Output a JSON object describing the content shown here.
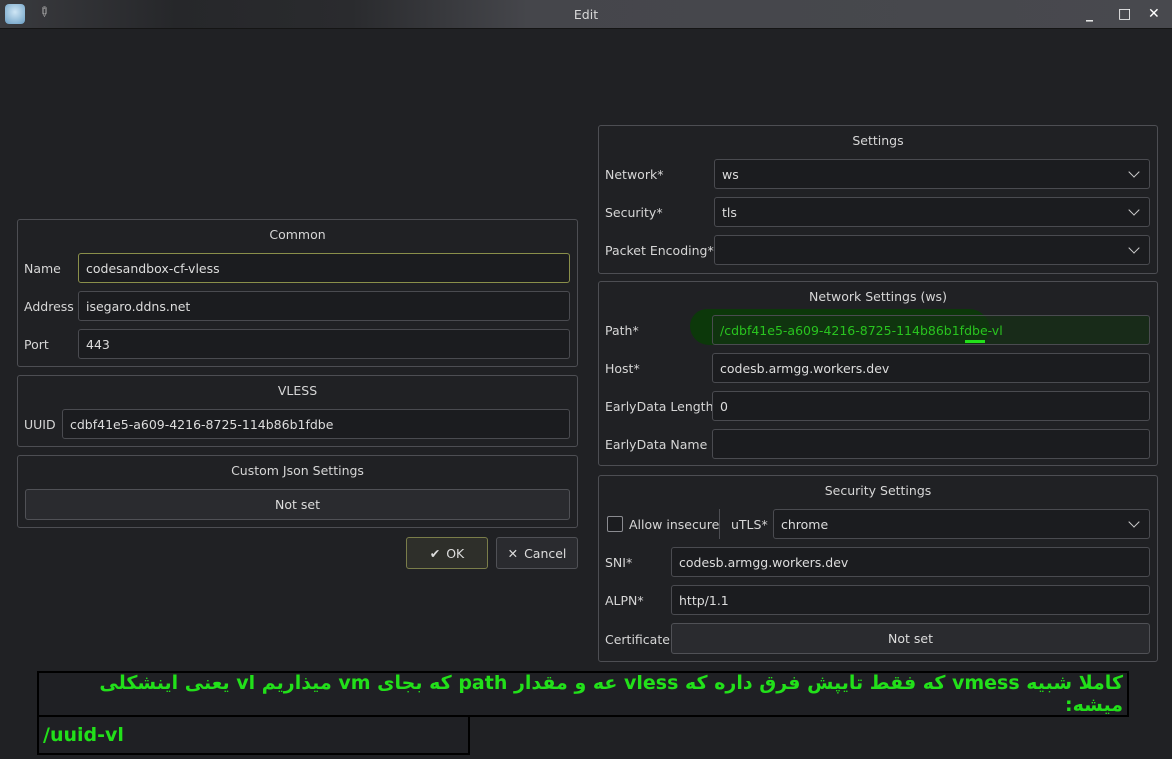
{
  "window": {
    "title": "Edit",
    "minimize": "_",
    "maximize": "□",
    "close": "✕"
  },
  "common": {
    "title": "Common",
    "name_label": "Name",
    "name_value": "codesandbox-cf-vless",
    "address_label": "Address",
    "address_value": "isegaro.ddns.net",
    "port_label": "Port",
    "port_value": "443"
  },
  "vless": {
    "title": "VLESS",
    "uuid_label": "UUID",
    "uuid_value": "cdbf41e5-a609-4216-8725-114b86b1fdbe"
  },
  "custom_json": {
    "title": "Custom Json Settings",
    "button": "Not set"
  },
  "dialog": {
    "ok": "OK",
    "cancel": "Cancel"
  },
  "settings": {
    "title": "Settings",
    "network_label": "Network*",
    "network_value": "ws",
    "security_label": "Security*",
    "security_value": "tls",
    "packet_label": "Packet Encoding*",
    "packet_value": ""
  },
  "network_settings": {
    "title": "Network Settings (ws)",
    "path_label": "Path*",
    "path_value": "/cdbf41e5-a609-4216-8725-114b86b1fdbe-vl",
    "host_label": "Host*",
    "host_value": "codesb.armgg.workers.dev",
    "edl_label": "EarlyData Length",
    "edl_value": "0",
    "edn_label": "EarlyData Name",
    "edn_value": ""
  },
  "security_settings": {
    "title": "Security Settings",
    "allow_insecure": "Allow insecure",
    "allow_insecure_checked": false,
    "utls_label": "uTLS*",
    "utls_value": "chrome",
    "sni_label": "SNI*",
    "sni_value": "codesb.armgg.workers.dev",
    "alpn_label": "ALPN*",
    "alpn_value": "http/1.1",
    "cert_label": "Certificate",
    "cert_button": "Not set"
  },
  "annotation": {
    "line1": "کاملا شبیه vmess که فقط تایپش فرق داره که vless عه و مقدار path که بجای vm میذاریم vl یعنی اینشکلی میشه:",
    "line2": "/uuid-vl"
  }
}
